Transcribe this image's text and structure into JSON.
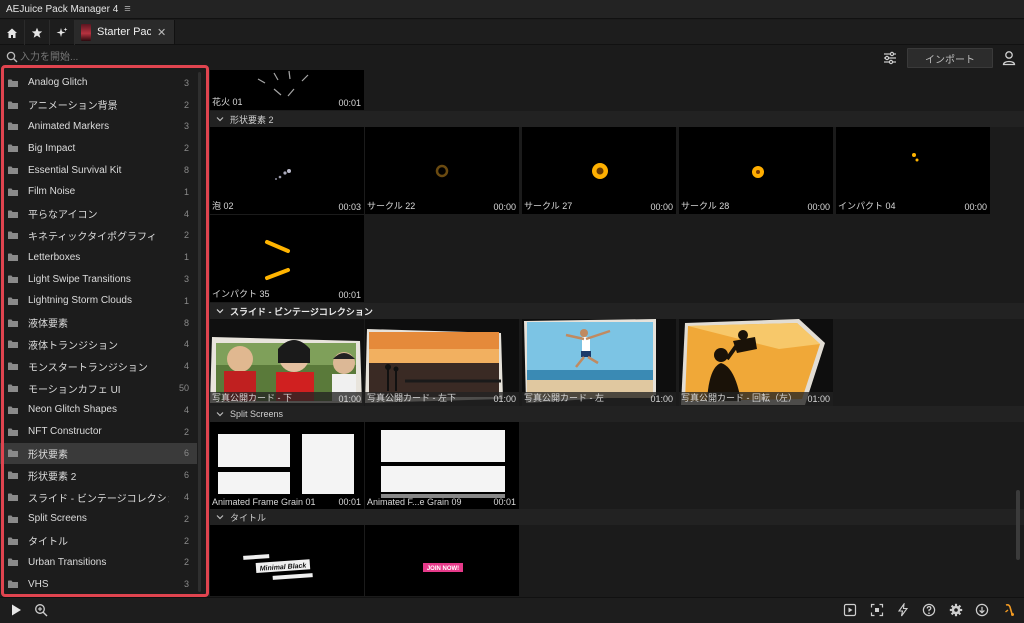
{
  "app": {
    "title": "AEJuice Pack Manager 4",
    "menu_icon": "hamburger-icon"
  },
  "tabs": {
    "home_icon": "home-icon",
    "favorites_icon": "star-icon",
    "sparkle_icon": "sparkle-icon",
    "active_pack": "Starter Pack",
    "close_icon": "close-icon"
  },
  "toolbar": {
    "search_placeholder": "入力を開始...",
    "import_label": "インポート"
  },
  "colors": {
    "accent_highlight": "#e0444f",
    "selected_row": "#3a3a3a",
    "background": "#1b1b1b",
    "orange_glow": "#ffb400",
    "pink_button": "#e63a8a"
  },
  "sidebar": {
    "items": [
      {
        "label": "Analog Glitch",
        "count": "3"
      },
      {
        "label": "アニメーション背景",
        "count": "2"
      },
      {
        "label": "Animated Markers",
        "count": "3"
      },
      {
        "label": "Big Impact",
        "count": "2"
      },
      {
        "label": "Essential Survival Kit",
        "count": "8"
      },
      {
        "label": "Film Noise",
        "count": "1"
      },
      {
        "label": "平らなアイコン",
        "count": "4"
      },
      {
        "label": "キネティックタイポグラフィ",
        "count": "2"
      },
      {
        "label": "Letterboxes",
        "count": "1"
      },
      {
        "label": "Light Swipe Transitions",
        "count": "3"
      },
      {
        "label": "Lightning Storm Clouds",
        "count": "1"
      },
      {
        "label": "液体要素",
        "count": "8"
      },
      {
        "label": "液体トランジション",
        "count": "4"
      },
      {
        "label": "モンスタートランジション",
        "count": "4"
      },
      {
        "label": "モーションカフェ UI",
        "count": "50"
      },
      {
        "label": "Neon Glitch Shapes",
        "count": "4"
      },
      {
        "label": "NFT Constructor",
        "count": "2"
      },
      {
        "label": "形状要素",
        "count": "6",
        "selected": true
      },
      {
        "label": "形状要素 2",
        "count": "6"
      },
      {
        "label": "スライド - ビンテージコレクション",
        "count": "4"
      },
      {
        "label": "Split Screens",
        "count": "2"
      },
      {
        "label": "タイトル",
        "count": "2"
      },
      {
        "label": "Urban Transitions",
        "count": "2"
      },
      {
        "label": "VHS",
        "count": "3"
      }
    ]
  },
  "content": {
    "top_tile": {
      "name": "花火 01",
      "duration": "00:01"
    },
    "sections": [
      {
        "title": "形状要素 2",
        "items": [
          {
            "name": "泡 02",
            "duration": "00:03"
          },
          {
            "name": "サークル 22",
            "duration": "00:00"
          },
          {
            "name": "サークル 27",
            "duration": "00:00"
          },
          {
            "name": "サークル 28",
            "duration": "00:00"
          },
          {
            "name": "インパクト 04",
            "duration": "00:00"
          },
          {
            "name": "インパクト 35",
            "duration": "00:01"
          }
        ]
      },
      {
        "title": "スライド - ビンテージコレクション",
        "items": [
          {
            "name": "写真公開カード - 下",
            "duration": "01:00"
          },
          {
            "name": "写真公開カード - 左下",
            "duration": "01:00"
          },
          {
            "name": "写真公開カード - 左",
            "duration": "01:00"
          },
          {
            "name": "写真公開カード - 回転（左）",
            "duration": "01:00"
          }
        ]
      },
      {
        "title": "Split Screens",
        "items": [
          {
            "name": "Animated Frame Grain 01",
            "duration": "00:01"
          },
          {
            "name": "Animated F...e Grain 09",
            "duration": "00:01"
          }
        ]
      },
      {
        "title": "タイトル",
        "items": [
          {
            "name": "",
            "duration": "",
            "art_text": "Minimal Black"
          },
          {
            "name": "",
            "duration": "",
            "art_text": "JOIN NOW!"
          }
        ]
      }
    ]
  },
  "bottombar": {
    "icons": [
      "play-icon",
      "zoom-icon",
      "preview-window-icon",
      "fit-screen-icon",
      "lightning-icon",
      "help-icon",
      "settings-icon",
      "download-icon",
      "aejuice-logo-icon"
    ]
  }
}
